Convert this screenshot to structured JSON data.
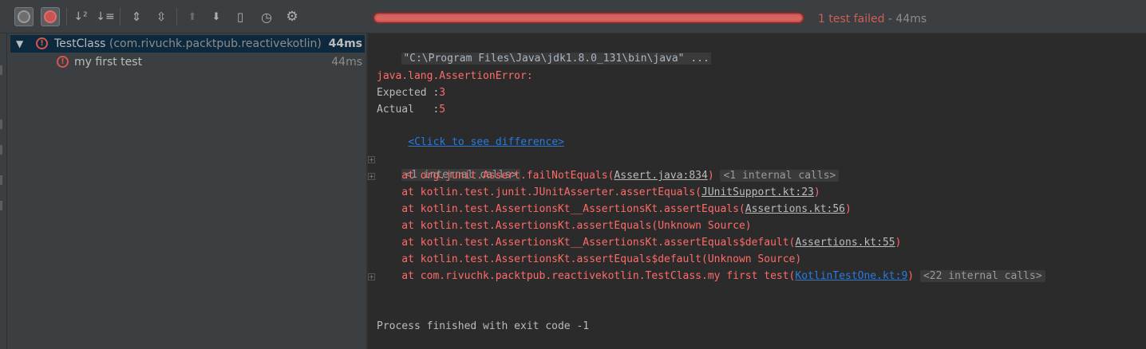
{
  "toolbar": {
    "buttons": [
      {
        "name": "show-passed-toggle",
        "icon": "check-circle-icon"
      },
      {
        "name": "show-ignored-toggle",
        "icon": "stop-circle-icon"
      },
      {
        "name": "sort-alphabetically-button",
        "icon": "sort-az-icon",
        "glyph": "↓²"
      },
      {
        "name": "sort-by-duration-button",
        "icon": "sort-duration-icon",
        "glyph": "↓≡"
      },
      {
        "name": "expand-all-button",
        "icon": "expand-all-icon",
        "glyph": "⇕"
      },
      {
        "name": "collapse-all-button",
        "icon": "collapse-all-icon",
        "glyph": "⇳"
      },
      {
        "name": "previous-failed-button",
        "icon": "arrow-up-icon",
        "glyph": "⬆"
      },
      {
        "name": "next-failed-button",
        "icon": "arrow-down-icon",
        "glyph": "⬇"
      },
      {
        "name": "export-results-button",
        "icon": "export-icon",
        "glyph": "▯"
      },
      {
        "name": "import-tests-button",
        "icon": "history-icon",
        "glyph": "◷"
      },
      {
        "name": "settings-button",
        "icon": "gear-icon",
        "glyph": "⚙"
      }
    ],
    "progress": 1.0,
    "status_failed": "1 test failed",
    "status_duration": " - 44ms",
    "colors": {
      "failed": "#c75450"
    }
  },
  "tree": {
    "root": {
      "label": "TestClass",
      "package": "(com.rivuchk.packtpub.reactivekotlin)",
      "duration": "44ms"
    },
    "children": [
      {
        "label": "my first test",
        "duration": "44ms"
      }
    ]
  },
  "console": {
    "command": "\"C:\\Program Files\\Java\\jdk1.8.0_131\\bin\\java\" ...",
    "error_class": "java.lang.AssertionError:",
    "expected_label": "Expected :",
    "expected_value": "3",
    "actual_label": "Actual   :",
    "actual_value": "5",
    "diff_link": "<Click to see difference>",
    "fold_top": "<1 internal calls>",
    "stack": [
      {
        "prefix": "    at org.junit.Assert.failNotEquals(",
        "src": "Assert.java:834",
        "suffix": ")",
        "fold": "<1 internal calls>",
        "plus": true
      },
      {
        "prefix": "    at kotlin.test.junit.JUnitAsserter.assertEquals(",
        "src": "JUnitSupport.kt:23",
        "suffix": ")",
        "fold": "",
        "plus": false
      },
      {
        "prefix": "    at kotlin.test.AssertionsKt__AssertionsKt.assertEquals(",
        "src": "Assertions.kt:56",
        "suffix": ")",
        "fold": "",
        "plus": false
      },
      {
        "prefix": "    at kotlin.test.AssertionsKt.assertEquals(Unknown Source)",
        "src": "",
        "suffix": "",
        "fold": "",
        "plus": false
      },
      {
        "prefix": "    at kotlin.test.AssertionsKt__AssertionsKt.assertEquals$default(",
        "src": "Assertions.kt:55",
        "suffix": ")",
        "fold": "",
        "plus": false
      },
      {
        "prefix": "    at kotlin.test.AssertionsKt.assertEquals$default(Unknown Source)",
        "src": "",
        "suffix": "",
        "fold": "",
        "plus": false
      },
      {
        "prefix": "    at com.rivuchk.packtpub.reactivekotlin.TestClass.my first test(",
        "src": "KotlinTestOne.kt:9",
        "suffix": ")",
        "fold": "<22 internal calls>",
        "plus": true,
        "link": true
      }
    ],
    "exit_message": "Process finished with exit code -1"
  }
}
